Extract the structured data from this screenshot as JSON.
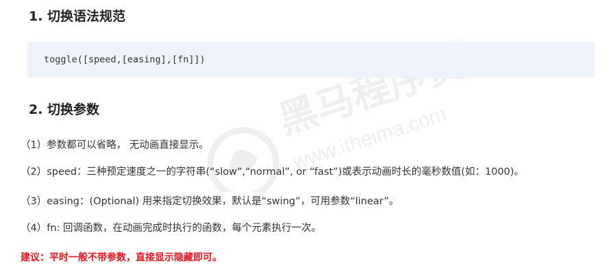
{
  "section1": {
    "title": "1. 切换语法规范",
    "code": "toggle([speed,[easing],[fn]])"
  },
  "section2": {
    "title": "2. 切换参数",
    "params": [
      "（1）参数都可以省略， 无动画直接显示。",
      "（2）speed：三种预定速度之一的字符串(“slow”,“normal”, or “fast”)或表示动画时长的毫秒数值(如：1000)。",
      "（3）easing：(Optional) 用来指定切换效果，默认是“swing”，可用参数“linear”。",
      "（4）fn:  回调函数，在动画完成时执行的函数，每个元素执行一次。"
    ],
    "tip": "建议：平时一般不带参数，直接显示隐藏即可。"
  },
  "watermark": {
    "brand": "黑马程序员",
    "url": "www.itheima.com",
    "tm": "TM"
  },
  "colors": {
    "tip": "#e8141e",
    "code_bg": "#eef3fb"
  }
}
